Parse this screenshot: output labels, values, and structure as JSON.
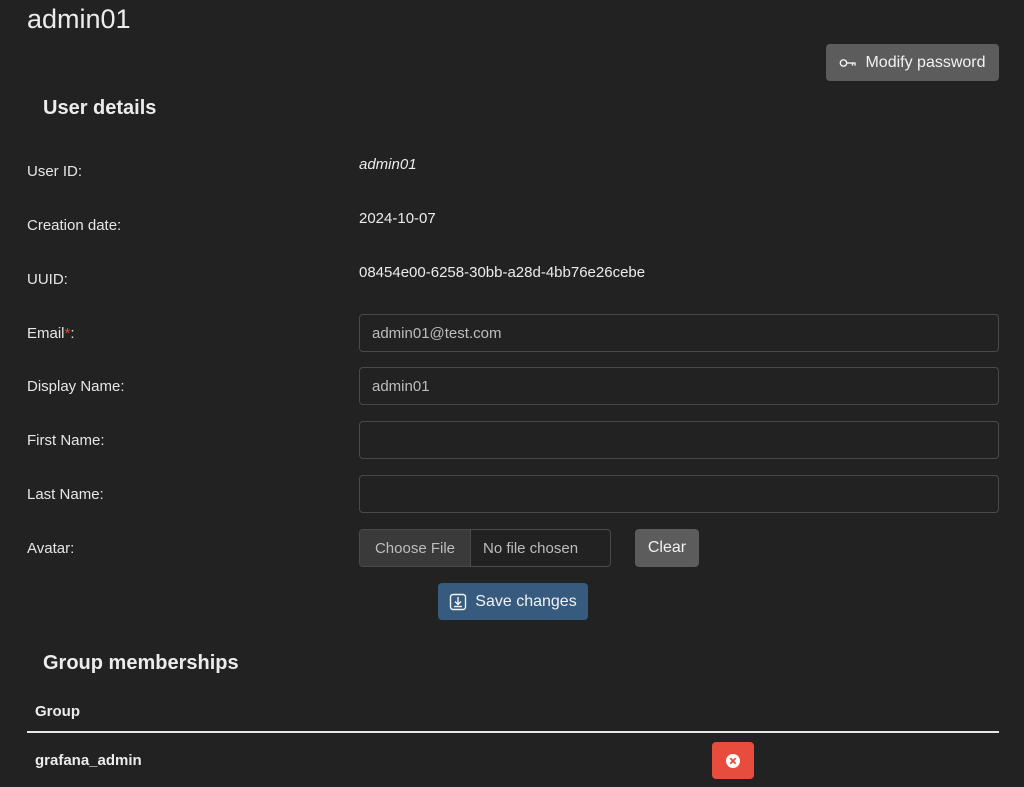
{
  "header": {
    "title": "admin01",
    "modify_password_label": "Modify password"
  },
  "user_details": {
    "section_title": "User details",
    "user_id_label": "User ID:",
    "user_id_value": "admin01",
    "creation_date_label": "Creation date:",
    "creation_date_value": "2024-10-07",
    "uuid_label": "UUID:",
    "uuid_value": "08454e00-6258-30bb-a28d-4bb76e26cebe",
    "email_label": "Email",
    "email_required_mark": "*",
    "email_suffix": ":",
    "email_value": "admin01@test.com",
    "display_name_label": "Display Name:",
    "display_name_value": "admin01",
    "first_name_label": "First Name:",
    "first_name_value": "",
    "last_name_label": "Last Name:",
    "last_name_value": "",
    "avatar_label": "Avatar:",
    "choose_file_label": "Choose File",
    "no_file_label": "No file chosen",
    "clear_label": "Clear",
    "save_label": "Save changes"
  },
  "group_memberships": {
    "section_title": "Group memberships",
    "column_group": "Group",
    "rows": [
      {
        "group": "grafana_admin"
      }
    ]
  },
  "colors": {
    "background": "#222222",
    "primary_button": "#375a7f",
    "secondary_button": "#5c5c5c",
    "danger_button": "#e74c3c",
    "required_mark": "#e0483b"
  },
  "icons": {
    "modify_password": "key-icon",
    "save": "download-box-icon",
    "remove": "close-circle-icon"
  }
}
